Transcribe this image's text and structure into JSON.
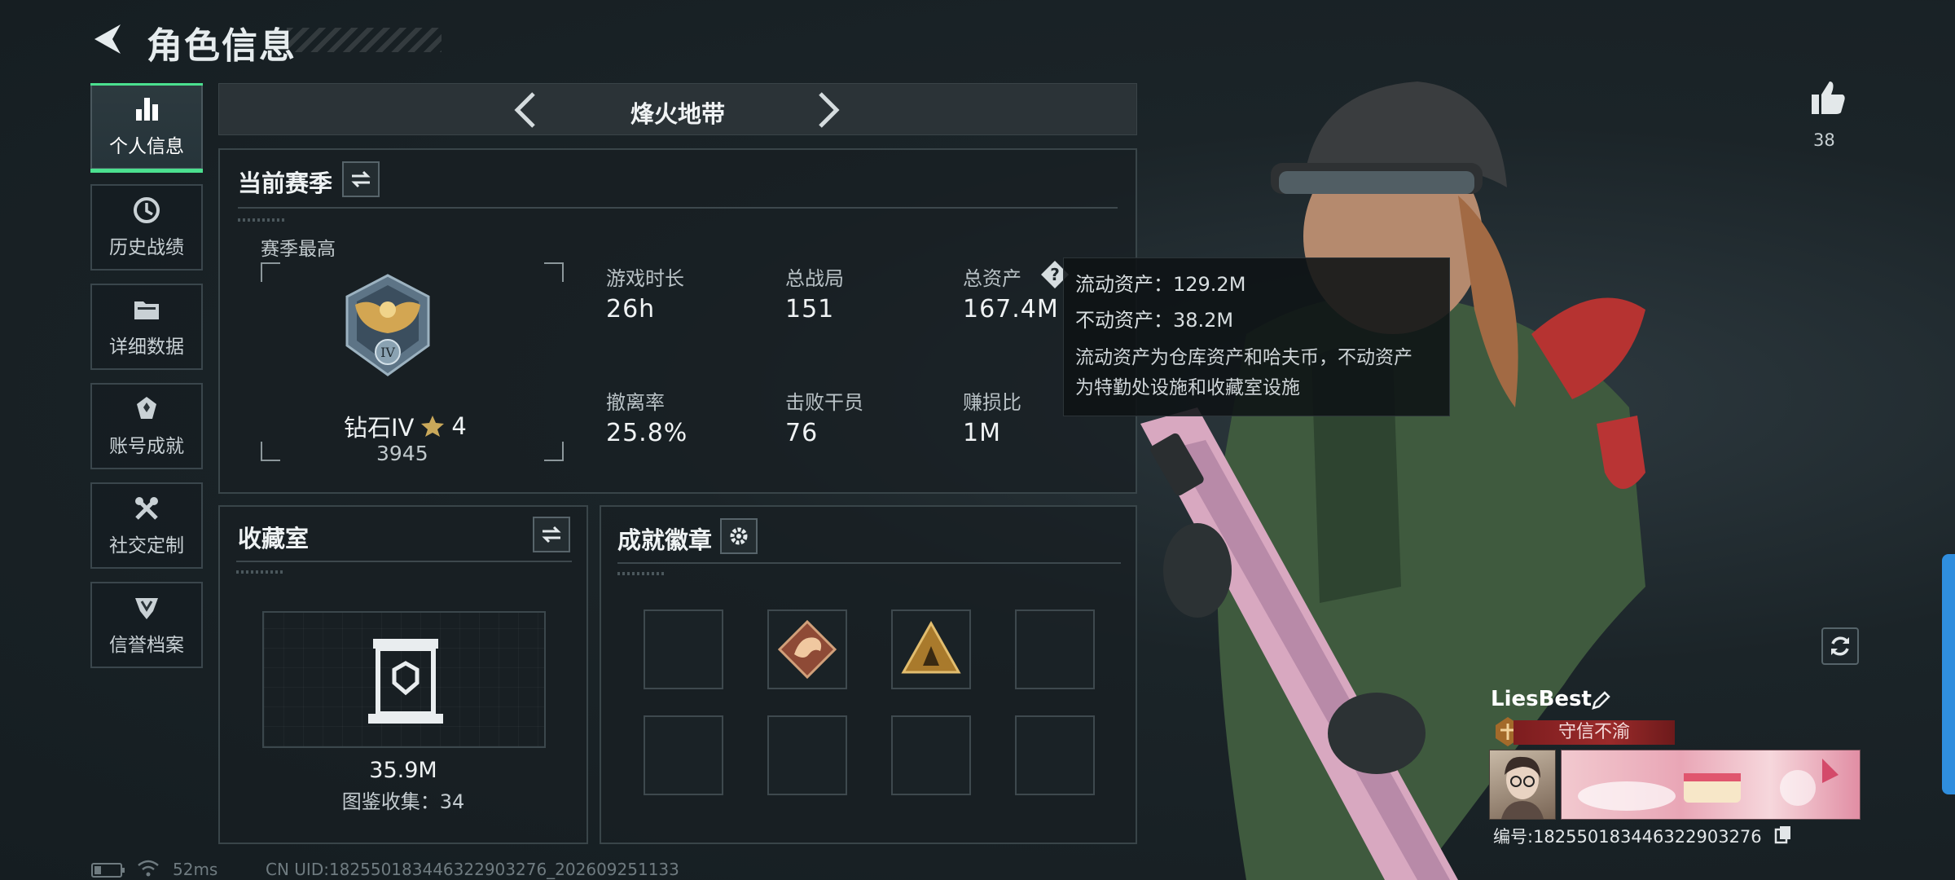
{
  "header": {
    "title": "角色信息"
  },
  "nav": [
    {
      "label": "个人信息",
      "icon": "bar-chart-icon",
      "active": true
    },
    {
      "label": "历史战绩",
      "icon": "clock-icon",
      "active": false
    },
    {
      "label": "详细数据",
      "icon": "folder-icon",
      "active": false
    },
    {
      "label": "账号成就",
      "icon": "achievement-icon",
      "active": false
    },
    {
      "label": "社交定制",
      "icon": "tools-icon",
      "active": false
    },
    {
      "label": "信誉档案",
      "icon": "shield-icon",
      "active": false
    }
  ],
  "mode_tab": {
    "title": "烽火地带"
  },
  "season": {
    "title": "当前赛季",
    "best_label": "赛季最高",
    "rank_name": "钻石IV",
    "rank_stars": "4",
    "rank_score": "3945",
    "rank_roman": "IV",
    "stats": [
      {
        "label": "游戏时长",
        "value": "26h"
      },
      {
        "label": "总战局",
        "value": "151"
      },
      {
        "label": "总资产",
        "value": "167.4M"
      },
      {
        "label": "撤离率",
        "value": "25.8%"
      },
      {
        "label": "击败干员",
        "value": "76"
      },
      {
        "label": "赚损比",
        "value": "1M"
      }
    ]
  },
  "tooltip": {
    "liquid": "流动资产：129.2M",
    "fixed": "不动资产：38.2M",
    "desc_line1": "流动资产为仓库资产和哈夫币，不动资产",
    "desc_line2": "为特勤处设施和收藏室设施"
  },
  "collection": {
    "title": "收藏室",
    "value": "35.9M",
    "gallery": "图鉴收集：34"
  },
  "badges": {
    "title": "成就徽章",
    "slots": [
      "empty",
      "dragon-badge",
      "triangle-badge",
      "empty",
      "empty",
      "empty",
      "empty",
      "empty"
    ]
  },
  "profile": {
    "name": "LiesBest",
    "motto": "守信不渝",
    "id_text": "编号:18255018344632290327​6"
  },
  "likes": {
    "count": "38"
  },
  "status": {
    "ping": "52ms",
    "uid": "CN UID:18255018344632290327​6_202609251133"
  },
  "colors": {
    "accent": "#4be08f",
    "panel_border": "#394549",
    "motto_bg": "#8a2424",
    "edge_blue": "#2f8ede"
  }
}
